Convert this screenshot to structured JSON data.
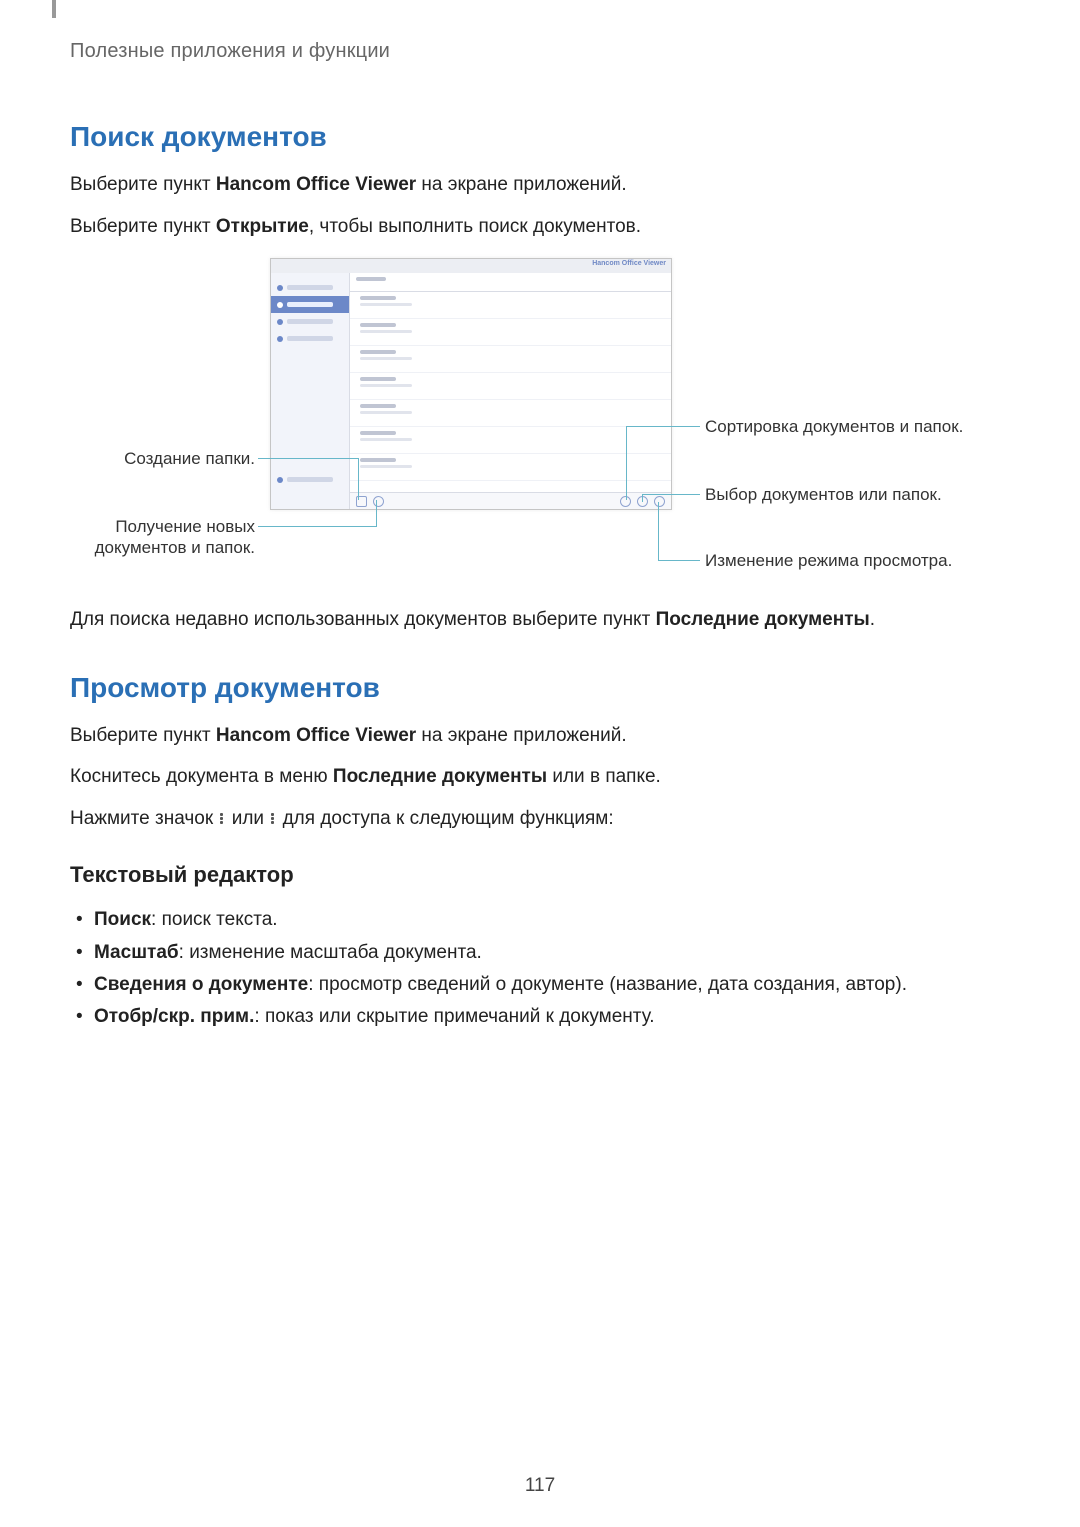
{
  "breadcrumb": "Полезные приложения и функции",
  "section1": {
    "title": "Поиск документов",
    "p1_pre": "Выберите пункт ",
    "p1_bold": "Hancom Office Viewer",
    "p1_post": " на экране приложений.",
    "p2_pre": "Выберите пункт ",
    "p2_bold": "Открытие",
    "p2_post": ", чтобы выполнить поиск документов.",
    "p3_pre": "Для поиска недавно использованных документов выберите пункт ",
    "p3_bold": "Последние документы",
    "p3_post": "."
  },
  "figure": {
    "app_title": "Hancom Office Viewer",
    "callout_left1": "Создание папки.",
    "callout_left2": "Получение новых документов и папок.",
    "callout_right1": "Сортировка документов и папок.",
    "callout_right2": "Выбор документов или папок.",
    "callout_right3": "Изменение режима просмотра."
  },
  "section2": {
    "title": "Просмотр документов",
    "p1_pre": "Выберите пункт ",
    "p1_bold": "Hancom Office Viewer",
    "p1_post": " на экране приложений.",
    "p2_pre": "Коснитесь документа в меню ",
    "p2_bold": "Последние документы",
    "p2_post": " или в папке.",
    "p3_pre": "Нажмите значок ",
    "p3_mid": " или ",
    "p3_post": " для доступа к следующим функциям:"
  },
  "subsection": {
    "title": "Текстовый редактор",
    "items": [
      {
        "bold": "Поиск",
        "rest": ": поиск текста."
      },
      {
        "bold": "Масштаб",
        "rest": ": изменение масштаба документа."
      },
      {
        "bold": "Сведения о документе",
        "rest": ": просмотр сведений о документе (название, дата создания, автор)."
      },
      {
        "bold": "Отобр/скр. прим.",
        "rest": ": показ или скрытие примечаний к документу."
      }
    ]
  },
  "page_number": "117"
}
